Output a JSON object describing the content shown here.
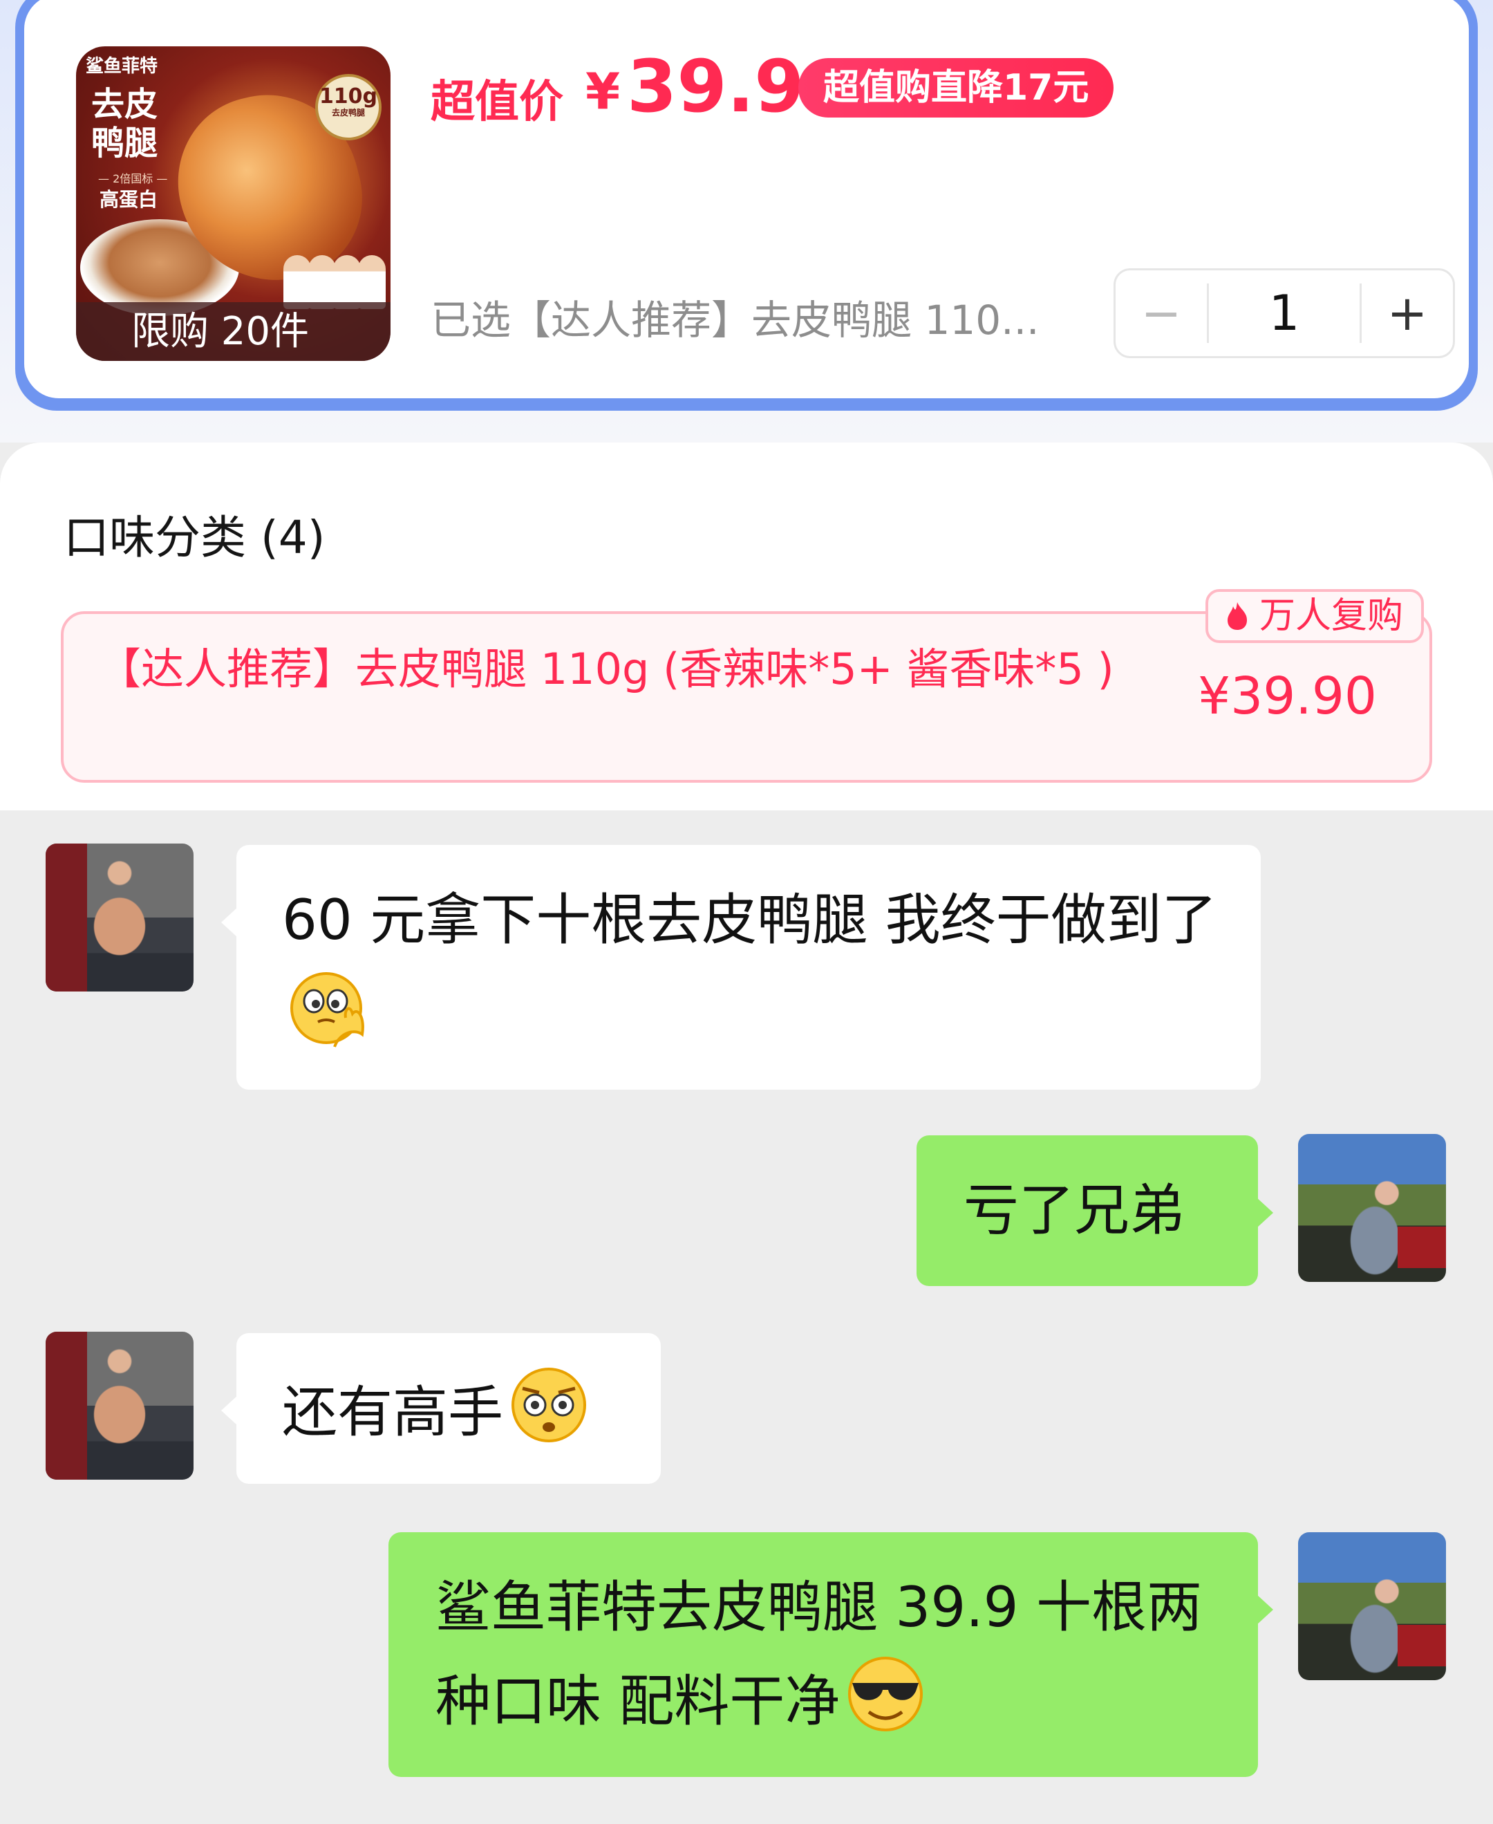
{
  "product": {
    "image": {
      "brand": "鲨鱼菲特",
      "name": "去皮鸭腿",
      "weight_badge": "110g",
      "weight_badge_sub": "去皮鸭腿",
      "standard": "— 2倍国标 —",
      "protein": "高蛋白"
    },
    "limit_label": "限购 20件",
    "price_label": "超值价",
    "currency": "¥",
    "price": "39.9",
    "discount_badge": "超值购直降17元",
    "selected_text": "已选【达人推荐】去皮鸭腿 110...",
    "quantity": "1",
    "qty_minus": "−",
    "qty_plus": "+"
  },
  "options": {
    "title": "口味分类 (4)",
    "variant": {
      "name": "【达人推荐】去皮鸭腿 110g (香辣味*5+ 酱香味*5 )",
      "price": "¥39.90",
      "badge": "万人复购"
    }
  },
  "chat": {
    "messages": [
      {
        "side": "left",
        "text": "60 元拿下十根去皮鸭腿 我终于做到了",
        "emoji": "thinking-face-icon"
      },
      {
        "side": "right",
        "text": "亏了兄弟",
        "emoji": ""
      },
      {
        "side": "left",
        "text": "还有高手",
        "emoji": "flushed-face-icon"
      },
      {
        "side": "right",
        "text": "鲨鱼菲特去皮鸭腿 39.9 十根两种口味 配料干净",
        "emoji": "sunglasses-face-icon"
      }
    ]
  },
  "colors": {
    "accent_red": "#ff2a52",
    "card_border_blue": "#6f95f0",
    "chat_green": "#95ec69",
    "chat_bg": "#ededed"
  }
}
